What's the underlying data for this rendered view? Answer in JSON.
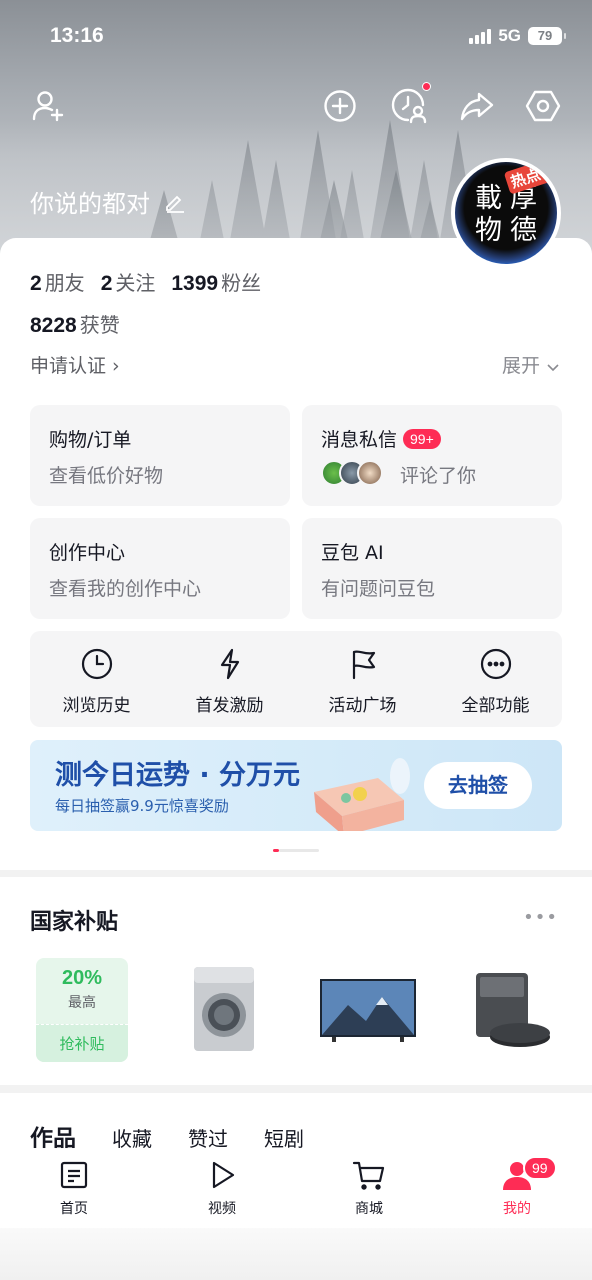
{
  "status_bar": {
    "time": "13:16",
    "network": "5G",
    "battery": "79"
  },
  "profile": {
    "name": "你说的都对",
    "avatar_chars": [
      "載",
      "厚",
      "物",
      "德"
    ],
    "avatar_tag": "热点中"
  },
  "stats": [
    {
      "num": "2",
      "label": "朋友"
    },
    {
      "num": "2",
      "label": "关注"
    },
    {
      "num": "1399",
      "label": "粉丝"
    }
  ],
  "likes": {
    "num": "8228",
    "label": "获赞"
  },
  "verify_text": "申请认证",
  "expand_text": "展开",
  "tiles": {
    "shopping": {
      "title": "购物/订单",
      "sub": "查看低价好物"
    },
    "messages": {
      "title": "消息私信",
      "badge": "99+",
      "sub": "评论了你"
    },
    "creator": {
      "title": "创作中心",
      "sub": "查看我的创作中心"
    },
    "doubao": {
      "title": "豆包 AI",
      "sub": "有问题问豆包"
    }
  },
  "functions": [
    {
      "label": "浏览历史",
      "icon": "clock-icon"
    },
    {
      "label": "首发激励",
      "icon": "lightning-icon"
    },
    {
      "label": "活动广场",
      "icon": "flag-icon"
    },
    {
      "label": "全部功能",
      "icon": "more-icon"
    }
  ],
  "banner": {
    "title": "测今日运势 · 分万元",
    "sub": "每日抽签赢9.9元惊喜奖励",
    "button": "去抽签"
  },
  "subsidy": {
    "title": "国家补贴",
    "promo_pct": "20%",
    "promo_label": "最高",
    "promo_button": "抢补贴"
  },
  "works_tabs": [
    "作品",
    "收藏",
    "赞过",
    "短剧"
  ],
  "bottom_nav": [
    {
      "label": "首页",
      "icon": "home-icon"
    },
    {
      "label": "视频",
      "icon": "play-icon"
    },
    {
      "label": "商城",
      "icon": "cart-icon"
    },
    {
      "label": "我的",
      "icon": "person-icon",
      "badge": "99"
    }
  ],
  "colors": {
    "accent": "#fe2c55",
    "banner_blue": "#1f4fa8",
    "subsidy_green": "#2fbb5d"
  }
}
